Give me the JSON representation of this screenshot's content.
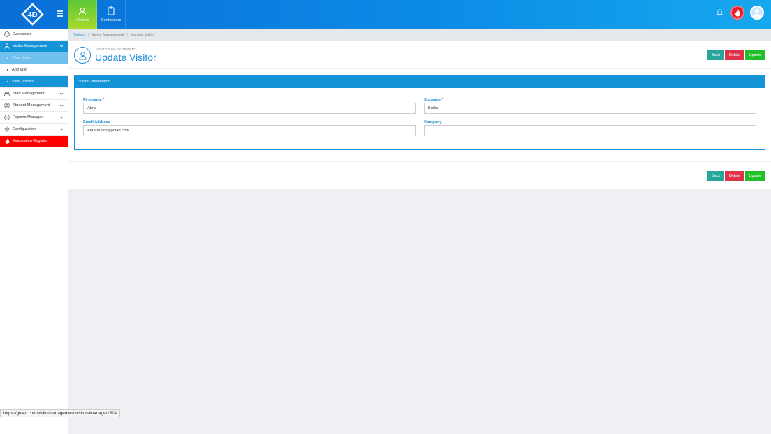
{
  "topbar": {
    "logo_text": "4D",
    "nav": [
      {
        "label": "Visitors"
      },
      {
        "label": "Contractors"
      }
    ]
  },
  "sidebar": {
    "items": [
      {
        "label": "Dashboard"
      },
      {
        "label": "Visitor Management"
      },
      {
        "label": "View Visits"
      },
      {
        "label": "Add Visit"
      },
      {
        "label": "View Visitors"
      },
      {
        "label": "Staff Management"
      },
      {
        "label": "Student Management"
      },
      {
        "label": "Reports Manager"
      },
      {
        "label": "Configuration"
      },
      {
        "label": "Evacuation Register"
      }
    ]
  },
  "breadcrumb": {
    "items": [
      "Visitors",
      "Visitor Management",
      "Manage Visitor"
    ]
  },
  "header": {
    "subtitle": "VISITOR MANAGEMENT",
    "title": "Update Visitor"
  },
  "buttons": {
    "back": "Back",
    "delete": "Delete",
    "update": "Update"
  },
  "panel": {
    "title": "Visitor Information",
    "fields": {
      "firstname": {
        "label": "Firstname",
        "value": "Abra",
        "required": "*"
      },
      "surname": {
        "label": "Surname",
        "value": "Burke",
        "required": "*"
      },
      "email": {
        "label": "Email Address",
        "value": "Abra.Burke@got4d.com"
      },
      "company": {
        "label": "Company",
        "value": ""
      }
    }
  },
  "status_url": "https://got4d.com/visitormanagement/visitors/manage/1514",
  "colors": {
    "primary": "#1493d7",
    "accent_green": "#1fbf2a",
    "danger": "#e0314a",
    "teal": "#26a69a",
    "evacuation": "#ff0000"
  }
}
